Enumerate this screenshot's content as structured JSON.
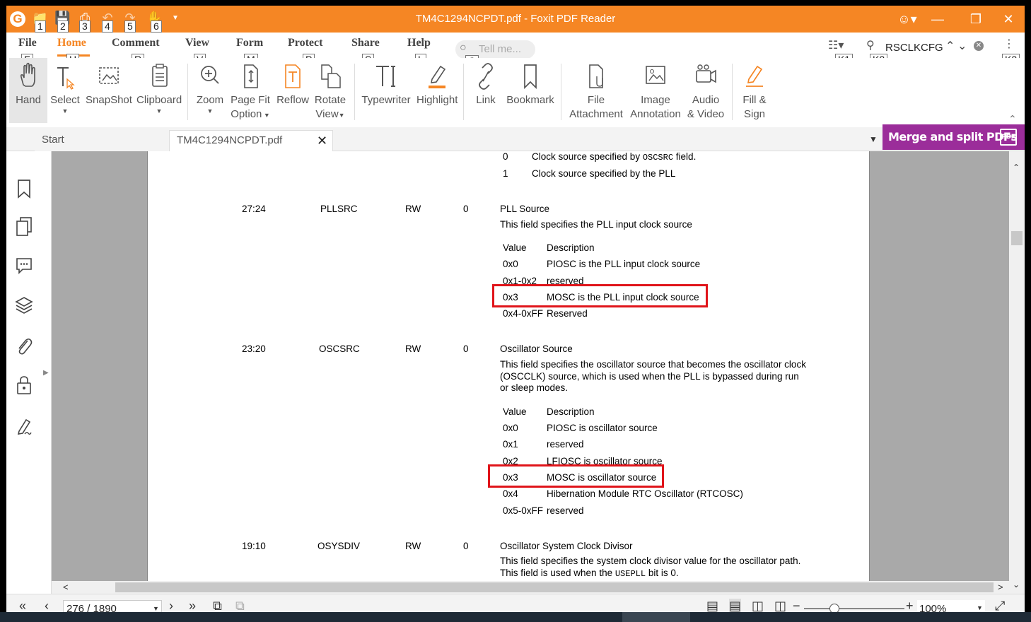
{
  "window": {
    "title": "TM4C1294NCPDT.pdf - Foxit PDF Reader"
  },
  "quick_access": {
    "keytips": [
      "1",
      "2",
      "3",
      "4",
      "5",
      "6"
    ]
  },
  "menu": {
    "items": [
      {
        "label": "File",
        "key": "F"
      },
      {
        "label": "Home",
        "key": "H"
      },
      {
        "label": "Comment",
        "key": "R"
      },
      {
        "label": "View",
        "key": "V"
      },
      {
        "label": "Form",
        "key": "M"
      },
      {
        "label": "Protect",
        "key": "P"
      },
      {
        "label": "Share",
        "key": "S"
      },
      {
        "label": "Help",
        "key": "L"
      }
    ],
    "tell_me": {
      "placeholder": "Tell me...",
      "key": "Q"
    },
    "search": {
      "value": "RSCLKCFG"
    },
    "keytips_right": [
      "K1",
      "K2",
      "K3"
    ]
  },
  "ribbon": {
    "hand": "Hand",
    "select": "Select",
    "snapshot": "SnapShot",
    "clipboard": "Clipboard",
    "zoom": "Zoom",
    "page_fit_1": "Page Fit",
    "page_fit_2": "Option",
    "reflow": "Reflow",
    "rotate_1": "Rotate",
    "rotate_2": "View",
    "typewriter": "Typewriter",
    "highlight": "Highlight",
    "link": "Link",
    "bookmark": "Bookmark",
    "file_1": "File",
    "file_2": "Attachment",
    "image_1": "Image",
    "image_2": "Annotation",
    "audio_1": "Audio",
    "audio_2": "& Video",
    "fill_1": "Fill &",
    "fill_2": "Sign"
  },
  "tabs": {
    "start": "Start",
    "doc": "TM4C1294NCPDT.pdf",
    "promo": "Merge and split PDFs"
  },
  "document": {
    "top_rows": [
      {
        "v": "0",
        "d_pre": "Clock source specified by ",
        "d_code": "OSCSRC",
        "d_post": " field."
      },
      {
        "v": "1",
        "d": "Clock source specified by the PLL"
      }
    ],
    "pllsrc": {
      "bits": "27:24",
      "name": "PLLSRC",
      "type": "RW",
      "reset": "0",
      "title": "PLL Source",
      "desc": "This field specifies the PLL input clock source",
      "hdr_value": "Value",
      "hdr_desc": "Description",
      "rows": [
        {
          "v": "0x0",
          "d": "PIOSC is the PLL input clock source"
        },
        {
          "v": "0x1-0x2",
          "d": "reserved"
        },
        {
          "v": "0x3",
          "d": "MOSC is the PLL input clock source"
        },
        {
          "v": "0x4-0xFF",
          "d": "Reserved"
        }
      ]
    },
    "oscsrc": {
      "bits": "23:20",
      "name": "OSCSRC",
      "type": "RW",
      "reset": "0",
      "title": "Oscillator Source",
      "desc1": "This field specifies the oscillator source that becomes the oscillator clock",
      "desc2": "(OSCCLK) source, which is used when the PLL is bypassed during run",
      "desc3": "or sleep modes.",
      "hdr_value": "Value",
      "hdr_desc": "Description",
      "rows": [
        {
          "v": "0x0",
          "d": "PIOSC is oscillator source"
        },
        {
          "v": "0x1",
          "d": "reserved"
        },
        {
          "v": "0x2",
          "d": "LFIOSC is oscillator source"
        },
        {
          "v": "0x3",
          "d": "MOSC is oscillator source"
        },
        {
          "v": "0x4",
          "d": "Hibernation Module RTC Oscillator (RTCOSC)"
        },
        {
          "v": "0x5-0xFF",
          "d": "reserved"
        }
      ]
    },
    "osysdiv": {
      "bits": "19:10",
      "name": "OSYSDIV",
      "type": "RW",
      "reset": "0",
      "title": "Oscillator System Clock Divisor",
      "desc1": "This field specifies the system clock divisor value for the oscillator path.",
      "desc2_pre": "This field is used when the ",
      "desc2_code": "USEPLL",
      "desc2_post": " bit is 0."
    }
  },
  "status": {
    "page_value": "276 / 1890",
    "zoom_value": "100%",
    "zoom_fraction": 0.3
  },
  "colors": {
    "brand_orange": "#f58624",
    "highlight_red": "#e0141a",
    "promo_purple": "#9b2d9a"
  }
}
